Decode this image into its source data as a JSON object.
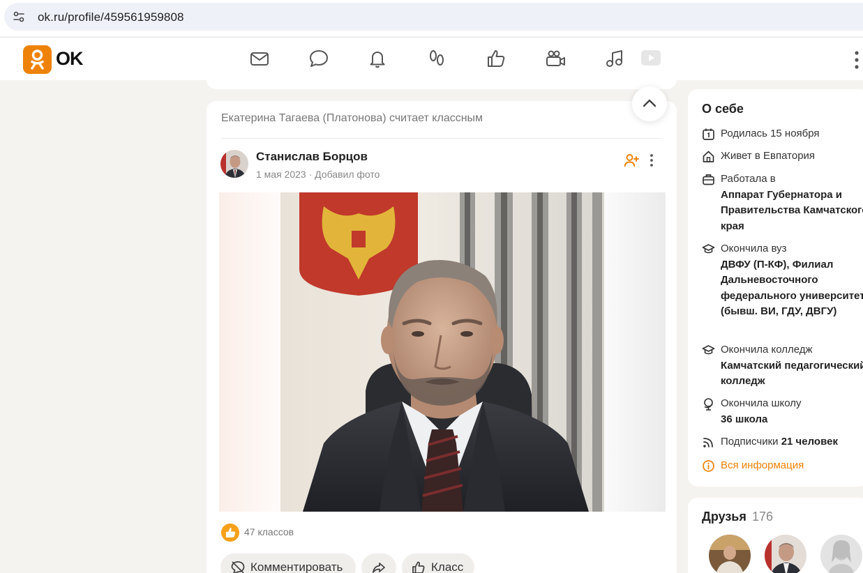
{
  "browser": {
    "url": "ok.ru/profile/459561959808"
  },
  "header": {
    "logo_text": "OK",
    "nav_icons": [
      "mail-icon",
      "chat-icon",
      "bell-icon",
      "guests-icon",
      "likes-icon",
      "video-call-icon",
      "music-icon",
      "video-icon"
    ],
    "accent_color": "#ee8208"
  },
  "feed": {
    "activity_text": "Екатерина Тагаева (Платонова) считает классным",
    "post": {
      "author": "Станислав Борцов",
      "date": "1 мая 2023",
      "separator": "·",
      "action": "Добавил фото",
      "likes_text": "47 классов",
      "buttons": {
        "comment": "Комментировать",
        "klass": "Класс"
      }
    }
  },
  "about": {
    "title": "О себе",
    "born": "Родилась 15 ноября",
    "lives": "Живет в Евпатория",
    "worked_label": "Работала в",
    "worked_place": "Аппарат Губернатора и Правительства Камчатского края",
    "university_label": "Окончила вуз",
    "university": "ДВФУ (П-КФ), Филиал Дальневосточного федерального университета (бывш. ВИ, ГДУ, ДВГУ)",
    "college_label": "Окончила колледж",
    "college": "Камчатский педагогический колледж",
    "school_label": "Окончила школу",
    "school": "36 школа",
    "subscribers_label": "Подписчики",
    "subscribers": "21 человек",
    "all_info": "Вся информация"
  },
  "friends": {
    "title": "Друзья",
    "count": "176"
  }
}
